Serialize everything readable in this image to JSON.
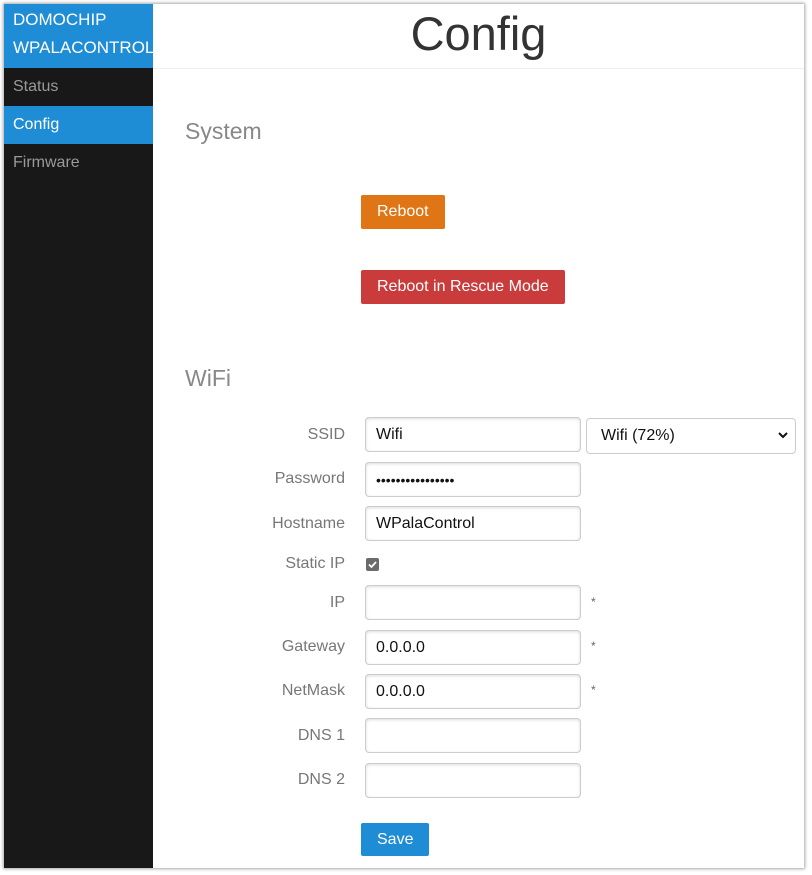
{
  "sidebar": {
    "brand_line1": "DOMOCHIP",
    "brand_line2": "WPALACONTROL",
    "items": [
      {
        "label": "Status",
        "active": false
      },
      {
        "label": "Config",
        "active": true
      },
      {
        "label": "Firmware",
        "active": false
      }
    ]
  },
  "header": {
    "title": "Config"
  },
  "system": {
    "title": "System",
    "reboot_label": "Reboot",
    "rescue_label": "Reboot in Rescue Mode"
  },
  "wifi": {
    "title": "WiFi",
    "ssid_label": "SSID",
    "ssid_value": "Wifi",
    "network_select_value": "Wifi (72%)",
    "password_label": "Password",
    "password_value": "••••••••••••••••",
    "hostname_label": "Hostname",
    "hostname_value": "WPalaControl",
    "static_ip_label": "Static IP",
    "static_ip_checked": true,
    "ip_label": "IP",
    "ip_value": "",
    "gateway_label": "Gateway",
    "gateway_value": "0.0.0.0",
    "netmask_label": "NetMask",
    "netmask_value": "0.0.0.0",
    "dns1_label": "DNS 1",
    "dns1_value": "",
    "dns2_label": "DNS 2",
    "dns2_value": "",
    "required_mark": "*",
    "save_label": "Save"
  },
  "colors": {
    "accent_blue": "#1f8dd6",
    "sidebar_bg": "#191818",
    "reboot_orange": "#df7514",
    "rescue_red": "#ca3c3c"
  },
  "icons": {
    "select_arrow": "chevron-down-icon",
    "checkbox": "checkmark-icon"
  }
}
